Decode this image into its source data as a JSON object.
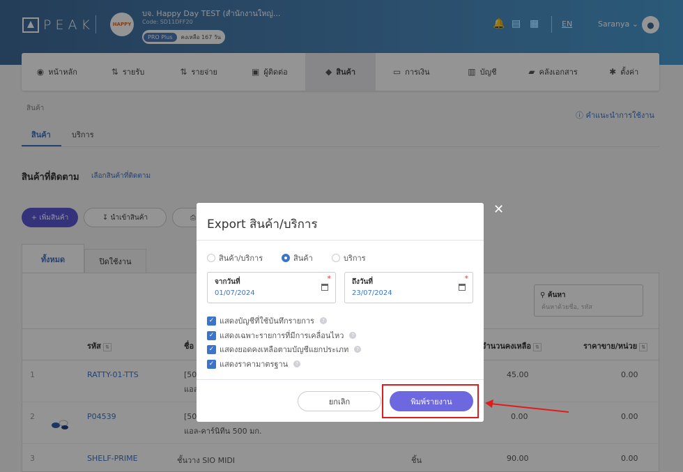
{
  "header": {
    "logo_text": "PEAK",
    "company_avatar_text": "HAPPY",
    "company_name": "บจ. Happy Day TEST (สำนักงานใหญ่...",
    "company_code": "Code: SD11DFF20",
    "plan": "PRO Plus",
    "plan_remaining": "คงเหลือ 167 วัน",
    "lang": "EN",
    "user": "Saranya",
    "icons": [
      "bell-icon",
      "document-icon",
      "apps-grid-icon"
    ]
  },
  "nav": {
    "items": [
      {
        "label": "หน้าหลัก",
        "icon": "◉"
      },
      {
        "label": "รายรับ",
        "icon": "⇅"
      },
      {
        "label": "รายจ่าย",
        "icon": "⇅"
      },
      {
        "label": "ผู้ติดต่อ",
        "icon": "▣"
      },
      {
        "label": "สินค้า",
        "icon": "◆"
      },
      {
        "label": "การเงิน",
        "icon": "▭"
      },
      {
        "label": "บัญชี",
        "icon": "▥"
      },
      {
        "label": "คลังเอกสาร",
        "icon": "▰"
      },
      {
        "label": "ตั้งค่า",
        "icon": "✱"
      }
    ],
    "active_index": 4
  },
  "page": {
    "breadcrumb": "สินค้า",
    "guide_link": "คำแนะนำการใช้งาน",
    "subtabs": [
      "สินค้า",
      "บริการ"
    ],
    "tracked_title": "สินค้าที่ติดตาม",
    "tracked_link": "เลือกสินค้าที่ติดตาม",
    "btn_add": "+ เพิ่มสินค้า",
    "btn_import": "นำเข้าสินค้า",
    "btn_print": "⎙",
    "panel_tabs": [
      "ทั้งหมด",
      "ปิดใช้งาน"
    ],
    "search_label": "ค้นหา",
    "search_placeholder": "ค้นหาด้วยชื่อ, รหัส"
  },
  "table": {
    "headers": {
      "code": "รหัส",
      "name": "ชื่อ",
      "remaining": "จำนวนคงเหลือ",
      "price": "ราคาขาย/หน่วย"
    },
    "rows": [
      {
        "no": "1",
        "code": "RATTY-01-TTS",
        "name1": "[50",
        "name2": "แอล",
        "unit": "",
        "remaining": "45.00",
        "price": "0.00"
      },
      {
        "no": "2",
        "code": "P04539",
        "name1": "[50",
        "name2": "แอล-คาร์นิทีน 500 มก.",
        "unit": "",
        "remaining": "0.00",
        "price": "0.00"
      },
      {
        "no": "3",
        "code": "SHELF-PRIME",
        "name1": "ชั้นวาง SIO MIDI",
        "name2": "",
        "unit": "ชิ้น",
        "remaining": "90.00",
        "price": "0.00"
      }
    ]
  },
  "modal": {
    "title": "Export สินค้า/บริการ",
    "radios": [
      "สินค้า/บริการ",
      "สินค้า",
      "บริการ"
    ],
    "radio_selected": 1,
    "from_label": "จากวันที่",
    "from_value": "01/07/2024",
    "to_label": "ถึงวันที่",
    "to_value": "23/07/2024",
    "required_mark": "*",
    "checkboxes": [
      "แสดงบัญชีที่ใช้บันทึกรายการ",
      "แสดงเฉพาะรายการที่มีการเคลื่อนไหว",
      "แสดงยอดคงเหลือตามบัญชีแยกประเภท",
      "แสดงราคามาตรฐาน"
    ],
    "cancel": "ยกเลิก",
    "print": "พิมพ์รายงาน",
    "close": "✕"
  },
  "colors": {
    "accent": "#3b74c9",
    "primary_button": "#6d67e0",
    "annotation": "#e01b1b"
  }
}
